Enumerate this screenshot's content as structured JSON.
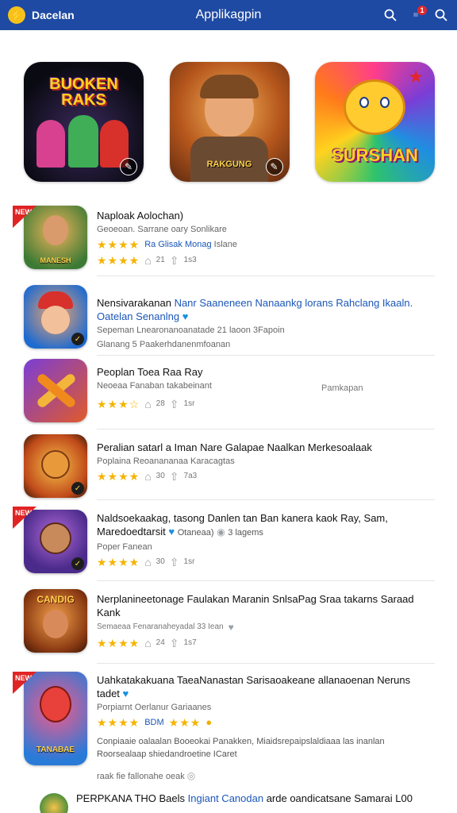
{
  "header": {
    "brand": "Dacelan",
    "title": "Applikagpin",
    "badge": "1",
    "notif_small": "III"
  },
  "featured": [
    {
      "text": "BUOKEN RAKS",
      "bg": "#1a1a2e"
    },
    {
      "text": "RAKGUNG",
      "bg": "#c9691f"
    },
    {
      "text": "SURSHAN",
      "bg": "#ef3d8f"
    }
  ],
  "apps": [
    {
      "title": "Naploak Aolochan)",
      "sub_a": "Geoeoan. Sarrane oary Sonlikare",
      "sub_b": "Ra Glisak Monag",
      "sub_c": "Islane",
      "stat1": "21",
      "stat2": "1s3",
      "icon_label": "MANESH",
      "ribbon": "NEW"
    },
    {
      "title_a": "Nensivarakanan ",
      "title_b": "Nanr Saaneneen Nanaankg lorans Rahclang Ikaaln.",
      "title_c": "Oatelan Senanlng",
      "sub": "Sepeman Lnearonanoanatade 21 laoon 3Fapoin",
      "meta": "Glanang 5 Paakerhdanenmfoanan",
      "icon_label": ""
    },
    {
      "title": "Peoplan Toea Raa Ray",
      "sub": "Neoeaa Fanaban takabeinant",
      "side": "Pamkapan",
      "stat1": "28",
      "stat2": "1sr",
      "icon_label": ""
    },
    {
      "title": "Peralian satarl a Iman Nare Galapae Naalkan Merkesoalaak",
      "sub": "Poplaina Reoanananaa Karacagtas",
      "stat1": "30",
      "stat2": "7a3",
      "icon_label": ""
    },
    {
      "title_a": "Naldsoekaakag, tasong Danlen tan Ban kanera kaok Ray, Sam,",
      "title_b": "Maredoedtarsit",
      "title_c": "Otaneaa)",
      "title_d": "3 lagems",
      "sub": "Poper Fanean",
      "stat1": "30",
      "stat2": "1sr",
      "icon_label": "",
      "ribbon": "NEW"
    },
    {
      "title": "Nerplanineetonage Faulakan Maranin SnlsaPag Sraa takarns Saraad Kank",
      "sub": "Semaeaa Fenaranaheyadal 33 Iean",
      "stat1": "24",
      "stat2": "1s7",
      "icon_label": "CANDIG"
    },
    {
      "title": "Uahkatakakuana TaeaNanastan Sarisaoakeane allanaoenan Neruns tadet",
      "sub": "Porpiarnt Oerlanur Gariaanes",
      "meta_a": "BDM",
      "desc": "Conpiaaie oalaalan Booeokai Panakken, Miaidsrepaipslaldiaaa las inanlan Roorsealaap shiedandroetine ICaret",
      "more": "raak fie fallonahe oeak",
      "ribbon": "NEW",
      "icon_label": "TANABAE"
    },
    {
      "title_a": "PERPKANA THO Baels ",
      "title_b": "Ingiant Canodan",
      "title_c": " arde oandicatsane Samarai L00"
    }
  ]
}
